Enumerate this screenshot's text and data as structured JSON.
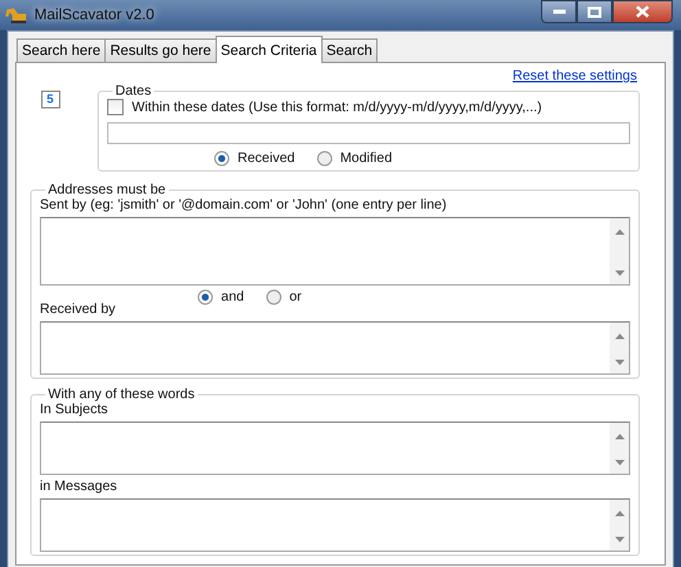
{
  "window": {
    "title": "MailScavator v2.0"
  },
  "tabs": [
    {
      "label": "Search here",
      "selected": false
    },
    {
      "label": "Results go here",
      "selected": false
    },
    {
      "label": "Search Criteria",
      "selected": true
    },
    {
      "label": "Search",
      "selected": false
    }
  ],
  "reset_link": "Reset these settings",
  "counter": "5",
  "dates": {
    "legend": "Dates",
    "within": {
      "label": "Within these dates (Use this format: m/d/yyyy-m/d/yyyy,m/d/yyyy,...)",
      "checked": false
    },
    "date_type": [
      {
        "label": "Received",
        "selected": true
      },
      {
        "label": "Modified",
        "selected": false
      }
    ]
  },
  "addresses": {
    "legend": "Addresses must be",
    "sent_by_label": "Sent by (eg: 'jsmith' or '@domain.com' or 'John' (one entry per line)",
    "received_by_label": "Received by",
    "logic": [
      {
        "label": "and",
        "selected": true
      },
      {
        "label": "or",
        "selected": false
      }
    ]
  },
  "words": {
    "legend": "With any of these words",
    "subjects_label": "In Subjects",
    "messages_label": "in Messages"
  }
}
